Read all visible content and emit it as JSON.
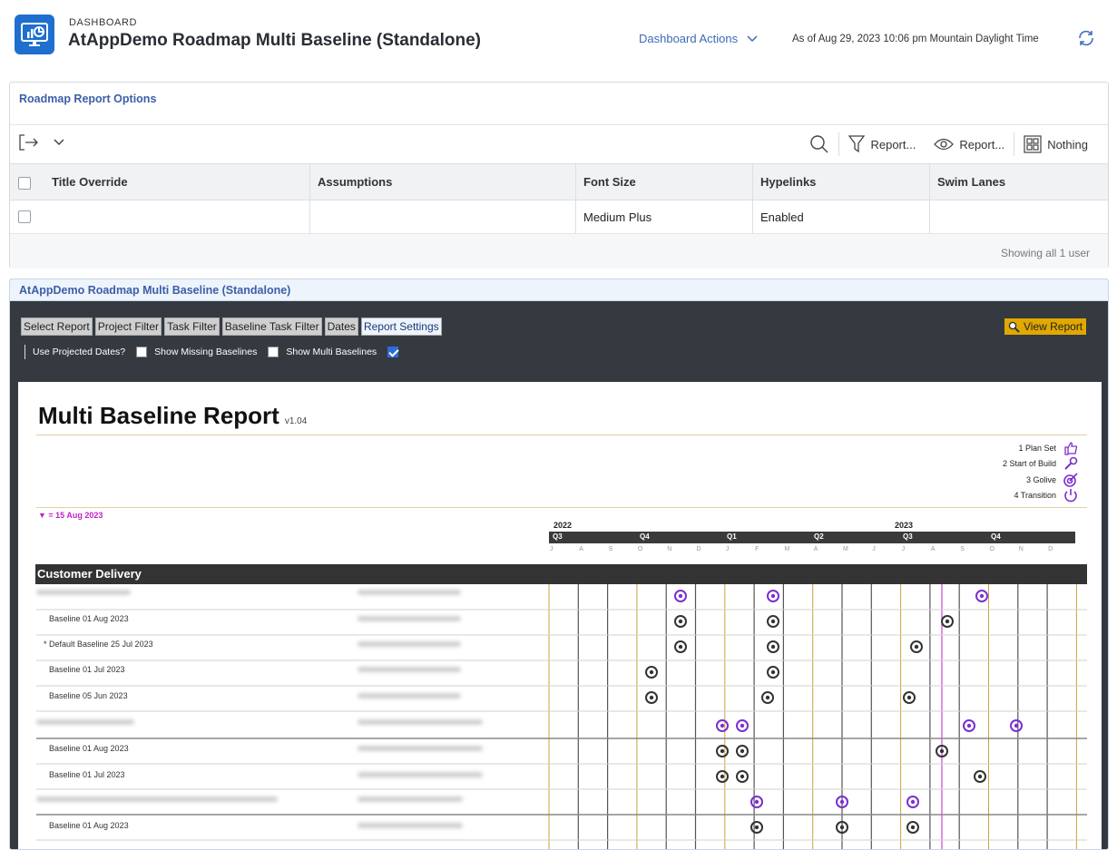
{
  "header": {
    "label": "DASHBOARD",
    "title": "AtAppDemo Roadmap Multi Baseline (Standalone)",
    "actions": "Dashboard Actions",
    "as_of": "As of  Aug 29, 2023 10:06 pm Mountain Daylight Time"
  },
  "options_panel": {
    "title": "Roadmap Report Options",
    "toolbar": {
      "filter": "Report...",
      "view": "Report...",
      "group": "Nothing"
    },
    "columns": [
      "Title Override",
      "Assumptions",
      "Font Size",
      "Hypelinks",
      "Swim Lanes"
    ],
    "row": {
      "title_override": "",
      "assumptions": "",
      "font_size": "Medium Plus",
      "hyperlinks": "Enabled",
      "swim_lanes": ""
    },
    "showing": "Showing all 1 user"
  },
  "report_panel": {
    "title": "AtAppDemo Roadmap Multi Baseline (Standalone)",
    "tabs": [
      "Select Report",
      "Project Filter",
      "Task Filter",
      "Baseline Task Filter",
      "Dates",
      "Report Settings"
    ],
    "view_report": "View Report",
    "options": {
      "projected": "Use Projected Dates?",
      "missing": "Show Missing Baselines",
      "multi": "Show Multi Baselines"
    }
  },
  "report": {
    "title": "Multi Baseline Report",
    "version": "v1.04",
    "legend": [
      "1 Plan Set",
      "2 Start of Build",
      "3 Golive",
      "4 Transition"
    ],
    "today": "▼ = 15 Aug 2023",
    "years": [
      "2022",
      "2023"
    ],
    "quarters": [
      "Q3",
      "Q4",
      "Q1",
      "Q2",
      "Q3",
      "Q4"
    ],
    "months": [
      "J",
      "A",
      "S",
      "O",
      "N",
      "D",
      "J",
      "F",
      "M",
      "A",
      "M",
      "J",
      "J",
      "A",
      "S",
      "O",
      "N",
      "D"
    ],
    "section": "Customer Delivery",
    "rows": [
      "Baseline 01 Aug 2023",
      "* Default Baseline 25 Jul 2023",
      "Baseline 01 Jul 2023",
      "Baseline 05 Jun 2023",
      "Baseline 01 Aug 2023",
      "Baseline 01 Jul 2023",
      "Baseline 01 Aug 2023"
    ]
  },
  "colors": {
    "accent": "#3c5ea8",
    "brand": "#1f6fcf",
    "milestone": "#7b2fd0",
    "today": "#c21fc9"
  }
}
